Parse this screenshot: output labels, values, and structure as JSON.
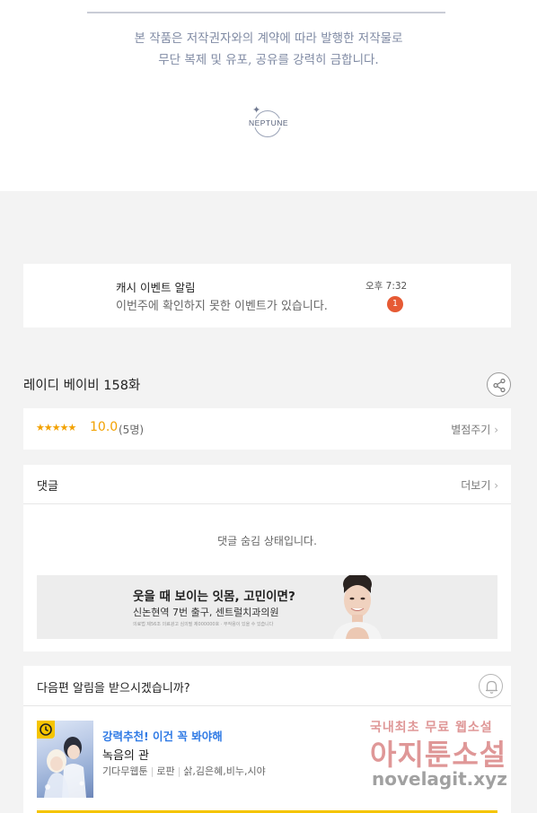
{
  "copyright": {
    "line1": "본 작품은 저작권자와의 계약에 따라 발행한 저작물로",
    "line2": "무단 복제 및 유포, 공유를 강력히 금합니다.",
    "logo_text": "NEPTUNE"
  },
  "event_notice": {
    "title": "캐시 이벤트 알림",
    "message": "이번주에 확인하지 못한 이벤트가 있습니다.",
    "time": "오후 7:32",
    "badge_count": "1"
  },
  "episode": {
    "title": "레이디 베이비 158화",
    "share_icon": "share-icon"
  },
  "rating": {
    "stars": "★★★★★",
    "stars_value": 5,
    "score": "10.0",
    "count": "(5명)",
    "rate_label": "별점주기",
    "color": "#f2a100"
  },
  "comments": {
    "label": "댓글",
    "more_label": "더보기",
    "hidden_message": "댓글 숨김 상태입니다."
  },
  "ad": {
    "headline": "웃을 때 보이는 잇몸, 고민이면?",
    "subline": "신논현역 7번 출구, 센트럴치과의원",
    "fineprint": "의료법 제56조 의료광고 심의필 제000000호 · 부작용이 있을 수 있습니다"
  },
  "next_episode": {
    "question": "다음편 알림을 받으시겠습니까?",
    "bell_icon": "bell-icon"
  },
  "recommendation": {
    "promo": "강력추천! 이건 꼭 봐야해",
    "title": "녹음의 관",
    "publisher": "기다무웹툰",
    "genre": "로판",
    "authors": "삵,김은혜,비누,시야",
    "accent": "#2f7ae5",
    "badge_color": "#f5c400"
  },
  "watermark": {
    "line1": "국내최초 무료 웹소설",
    "line2": "아지툰소설",
    "line3": "novelagit.xyz"
  }
}
